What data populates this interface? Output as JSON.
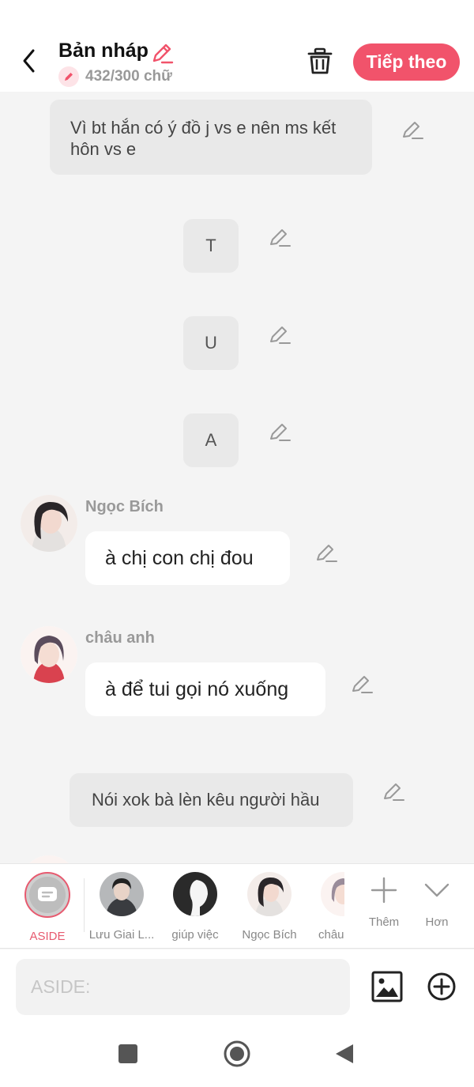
{
  "header": {
    "back_icon": "chevron-left-icon",
    "title": "Bản nháp",
    "title_edit_icon": "pencil-icon",
    "word_count": "432/300 chữ",
    "trash_icon": "trash-icon",
    "next_label": "Tiếp theo",
    "accent": "#f1536b"
  },
  "chat": {
    "narration_1": "Vì bt hắn có ý đồ j vs e nên ms kết hôn vs e",
    "narration_t": "T",
    "narration_u": "U",
    "narration_a": "A",
    "message_1": {
      "name": "Ngọc Bích",
      "text": "à chị con chị đou"
    },
    "message_2": {
      "name": "châu anh",
      "text": "à để tui gọi nó xuống"
    },
    "narration_2": "Nói xok bà lèn kêu người hầu",
    "edit_icon": "pencil-icon"
  },
  "character_bar": {
    "items": [
      {
        "label": "ASIDE",
        "icon": "message-icon"
      },
      {
        "label": "Lưu Giai L..."
      },
      {
        "label": "giúp việc"
      },
      {
        "label": "Ngọc Bích"
      },
      {
        "label": "châu"
      }
    ],
    "add_label": "Thêm",
    "more_label": "Hơn"
  },
  "input": {
    "placeholder": "ASIDE:",
    "image_icon": "image-icon",
    "plus_icon": "plus-circle-icon"
  },
  "nav": {
    "recents_icon": "square-icon",
    "home_icon": "circle-icon",
    "back_icon": "triangle-back-icon"
  }
}
